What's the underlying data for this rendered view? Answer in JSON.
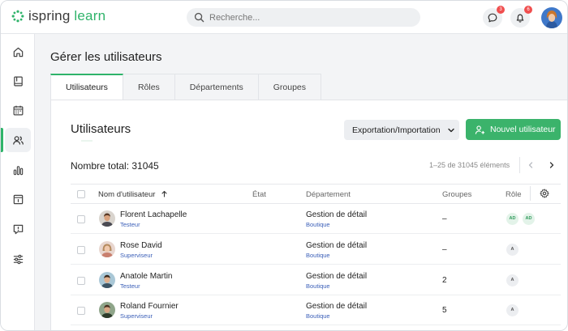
{
  "brand": {
    "name_part1": "ispring",
    "name_part2": "learn",
    "accent": "#2fb36a"
  },
  "search": {
    "placeholder": "Recherche..."
  },
  "header": {
    "icons": [
      {
        "name": "chat-icon",
        "badge": "3"
      },
      {
        "name": "bell-icon",
        "badge": "6"
      }
    ]
  },
  "sidebar": {
    "items": [
      {
        "icon": "home-icon"
      },
      {
        "icon": "book-icon"
      },
      {
        "icon": "calendar-icon"
      },
      {
        "icon": "users-icon",
        "active": true
      },
      {
        "icon": "chart-icon"
      },
      {
        "icon": "page-icon"
      },
      {
        "icon": "feedback-icon"
      },
      {
        "icon": "settings-sliders-icon"
      }
    ]
  },
  "page": {
    "title": "Gérer les utilisateurs"
  },
  "tabs": [
    "Utilisateurs",
    "Rôles",
    "Départements",
    "Groupes"
  ],
  "section": {
    "title": "Utilisateurs",
    "export_label": "Exportation/Importation",
    "new_user_label": "Nouvel utilisateur",
    "total_label": "Nombre total: 31045",
    "range_label": "1–25 de 31045 éléments"
  },
  "table": {
    "columns": {
      "name": "Nom d'utilisateur",
      "state": "État",
      "department": "Département",
      "groups": "Groupes",
      "role": "Rôle"
    },
    "rows": [
      {
        "name": "Florent Lachapelle",
        "subtitle": "Testeur",
        "department": "Gestion de détail",
        "dept_sub": "Boutique",
        "groups": "–",
        "roles": [
          "AD",
          "AD"
        ]
      },
      {
        "name": "Rose David",
        "subtitle": "Superviseur",
        "department": "Gestion de détail",
        "dept_sub": "Boutique",
        "groups": "–",
        "roles": [
          "A"
        ]
      },
      {
        "name": "Anatole  Martin",
        "subtitle": "Testeur",
        "department": "Gestion de détail",
        "dept_sub": "Boutique",
        "groups": "2",
        "roles": [
          "A"
        ]
      },
      {
        "name": "Roland  Fournier",
        "subtitle": "Superviseur",
        "department": "Gestion de détail",
        "dept_sub": "Boutique",
        "groups": "5",
        "roles": [
          "A"
        ]
      }
    ]
  }
}
